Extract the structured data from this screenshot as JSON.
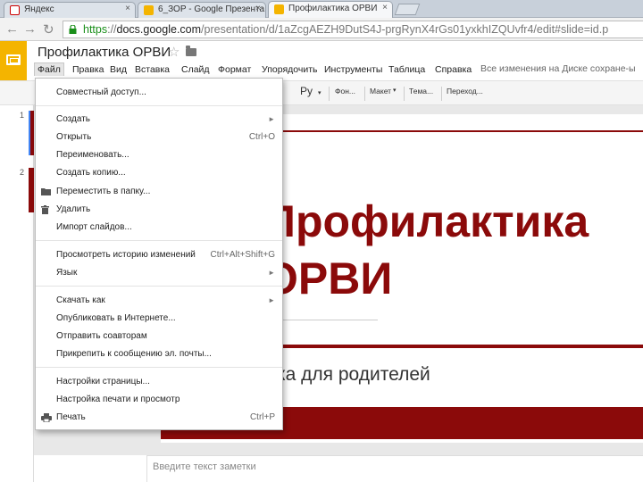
{
  "browser": {
    "tabs": [
      {
        "label": "Яндекс",
        "favicon_color": "#cc0000",
        "active": false
      },
      {
        "label": "6_ЗОР - Google Презента",
        "favicon_color": "#f4b400",
        "active": false
      },
      {
        "label": "Профилактика ОРВИ",
        "favicon_color": "#f4b400",
        "active": true
      }
    ],
    "tab_close": "×",
    "nav": {
      "back": "←",
      "forward": "→",
      "reload": "↻"
    },
    "url": {
      "scheme": "https",
      "sep": "://",
      "host": "docs.google.com",
      "path": "/presentation/d/1aZcgAEZH9DutS4J-prgRynX4rGs01yxkhIZQUvfr4/edit#slide=id.p"
    }
  },
  "app": {
    "title": "Профилактика ОРВИ",
    "star": "☆",
    "accent_color": "#f4b400",
    "menus": [
      "Файл",
      "Правка",
      "Вид",
      "Вставка",
      "Слайд",
      "Формат",
      "Упорядочить",
      "Инструменты",
      "Таблица",
      "Справка"
    ],
    "save_status": "Все изменения на Диске сохране-ы"
  },
  "toolbar": {
    "font": "Ру",
    "font_menu": "Фон...",
    "layout_menu": "Макет",
    "theme_menu": "Тема...",
    "transition_menu": "Переход..."
  },
  "filmstrip": {
    "slide_numbers": [
      "1",
      "2"
    ]
  },
  "slide": {
    "title": "Профилактика ОРВИ",
    "subtitle": "ка для родителей",
    "brand_color": "#8b0a0a"
  },
  "notes": {
    "placeholder": "Введите текст заметки"
  },
  "file_menu": {
    "share": "Совместный доступ...",
    "create": "Создать",
    "open": "Открыть",
    "open_shortcut": "Ctrl+O",
    "rename": "Переименовать...",
    "copy": "Создать копию...",
    "move": "Переместить в папку...",
    "delete": "Удалить",
    "import": "Импорт слайдов...",
    "history": "Просмотреть историю изменений",
    "history_shortcut": "Ctrl+Alt+Shift+G",
    "language": "Язык",
    "download": "Скачать как",
    "publish": "Опубликовать в Интернете...",
    "email_collab": "Отправить соавторам",
    "attach_email": "Прикрепить к сообщению эл. почты...",
    "page_setup": "Настройки страницы...",
    "print_setup": "Настройка печати и просмотр",
    "print": "Печать",
    "print_shortcut": "Ctrl+P",
    "submenu_arrow": "►"
  }
}
